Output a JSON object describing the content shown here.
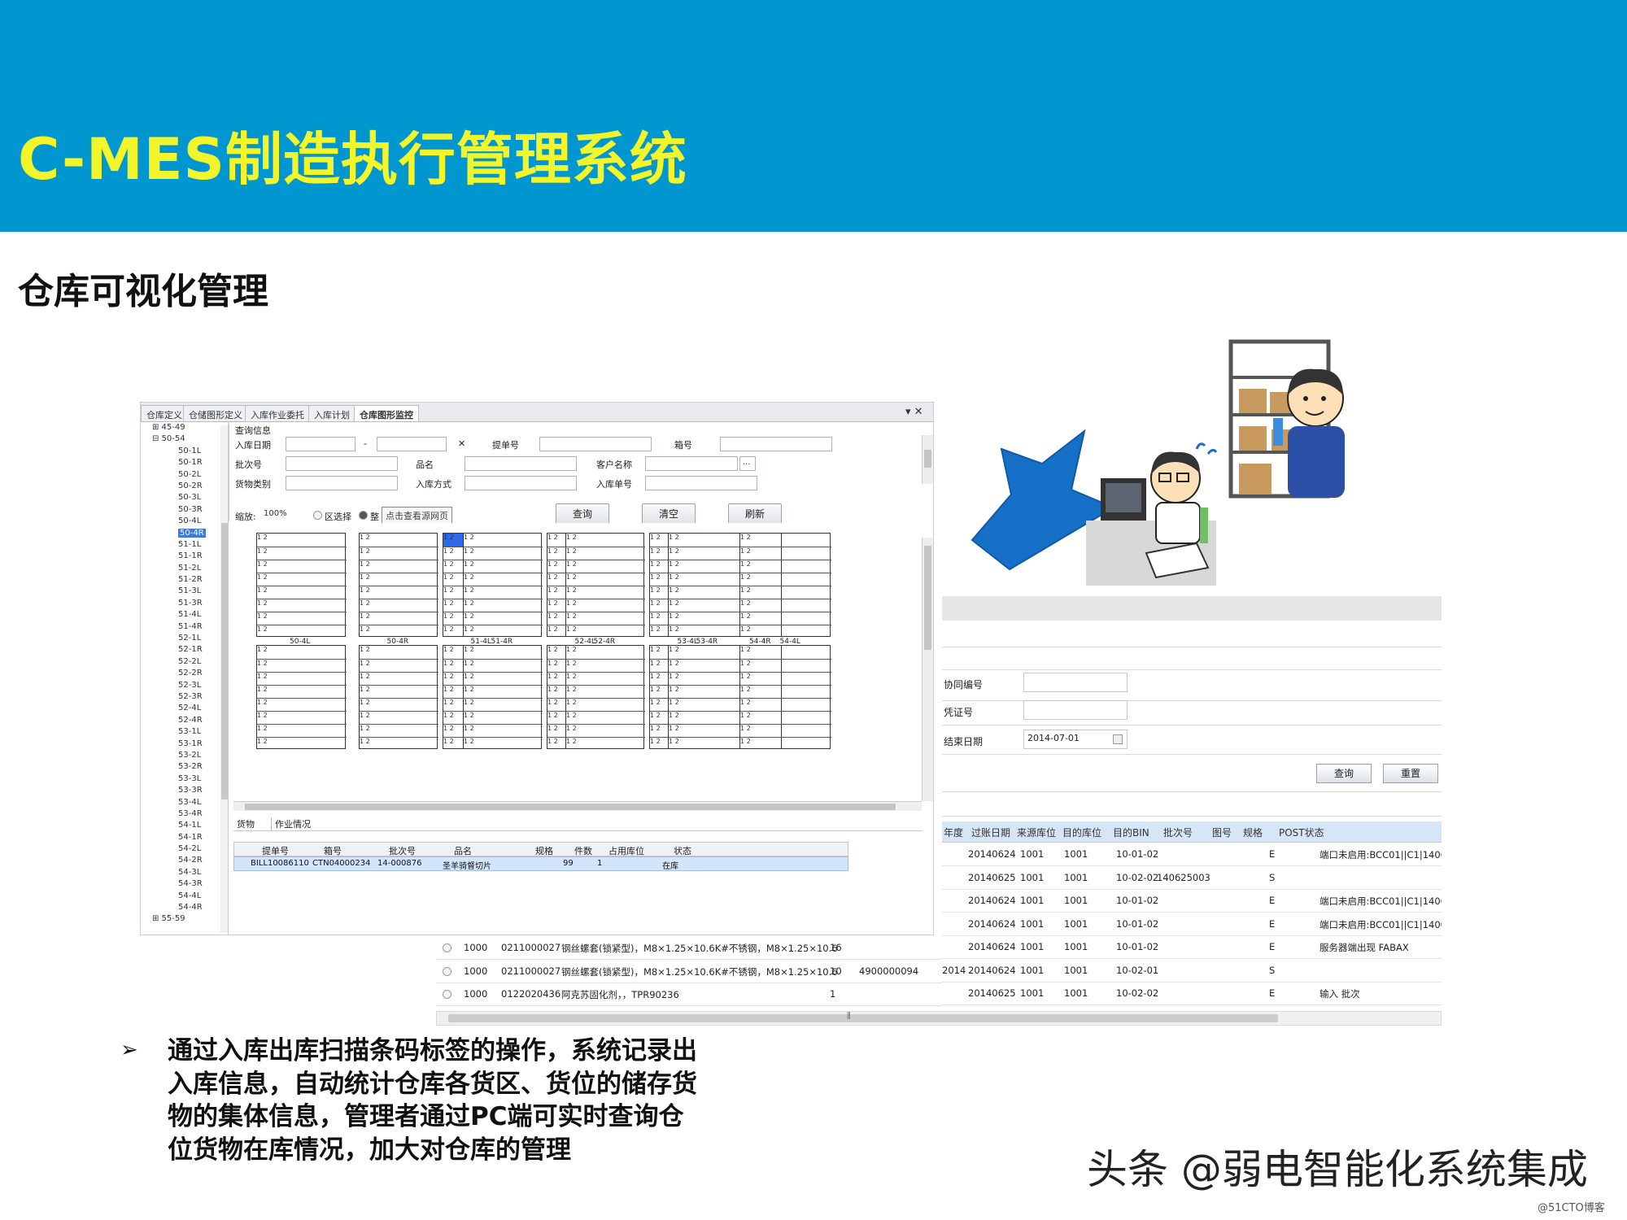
{
  "slide": {
    "title": "C-MES制造执行管理系统",
    "subtitle": "仓库可视化管理",
    "bullet": "➢",
    "body": "通过入库出库扫描条码标签的操作，系统记录出入库信息，自动统计仓库各货区、货位的储存货物的集体信息，管理者通过PC端可实时查询仓位货物在库情况，加大对仓库的管理",
    "watermark": "头条 @弱电智能化系统集成",
    "watermark_small": "@51CTO博客"
  },
  "colors": {
    "banner": "#0096cf",
    "title": "#f2f52a",
    "arrow": "#1670c8",
    "selection": "#2c68e8"
  },
  "left_app": {
    "tabs": [
      "仓库定义",
      "仓储图形定义",
      "入库作业委托",
      "入库计划",
      "仓库图形监控"
    ],
    "tab_controls": "▾ ✕",
    "tree": {
      "groups": [
        "⊞ 45-49",
        "⊟ 50-54",
        "⊞ 55-59"
      ],
      "items": [
        "50-1L",
        "50-1R",
        "50-2L",
        "50-2R",
        "50-3L",
        "50-3R",
        "50-4L",
        "50-4R",
        "51-1L",
        "51-1R",
        "51-2L",
        "51-2R",
        "51-3L",
        "51-3R",
        "51-4L",
        "51-4R",
        "52-1L",
        "52-1R",
        "52-2L",
        "52-2R",
        "52-3L",
        "52-3R",
        "52-4L",
        "52-4R",
        "53-1L",
        "53-1R",
        "53-2L",
        "53-2R",
        "53-3L",
        "53-3R",
        "53-4L",
        "53-4R",
        "54-1L",
        "54-1R",
        "54-2L",
        "54-2R",
        "54-3L",
        "54-3R",
        "54-4L",
        "54-4R"
      ],
      "selected": "50-4R"
    },
    "query": {
      "section": "查询信息",
      "in_date": "入库日期",
      "dash": "-",
      "bill_no": "提单号",
      "box_no": "箱号",
      "batch_no": "批次号",
      "product": "品名",
      "customer": "客户名称",
      "goods_type": "货物类别",
      "in_method": "入库方式",
      "in_no": "入库单号",
      "ellipsis": "...",
      "clear_x": "✕"
    },
    "toolbar": {
      "zoom_label": "缩放:",
      "zoom_value": "100%",
      "radio_area": "区选择",
      "radio_all": "整",
      "tooltip": "点击查看源网页",
      "query": "查询",
      "clear": "清空",
      "refresh": "刷新"
    },
    "rack_labels_top": [
      "50-4L",
      "50-4R",
      "51-4L",
      "51-4R",
      "52-4L",
      "52-4R",
      "53-4L",
      "53-4R",
      "54-4L",
      "54-4R"
    ],
    "rack_cell_text": "1 2",
    "lower_tabs": [
      "货物",
      "作业情况"
    ],
    "grid": {
      "headers": [
        "提单号",
        "箱号",
        "批次号",
        "品名",
        "规格",
        "件数",
        "占用库位",
        "状态"
      ],
      "row": [
        "BILL10086110",
        "CTN04000234",
        "14-000876",
        "圣羊骑督切片",
        "",
        "99",
        "1",
        "在库"
      ]
    }
  },
  "right_app": {
    "labels": [
      "协同编号",
      "凭证号",
      "结束日期"
    ],
    "end_date": "2014-07-01",
    "buttons": [
      "查询",
      "重置"
    ],
    "headers": [
      "年度",
      "过账日期",
      "来源库位",
      "目的库位",
      "目的BIN",
      "批次号",
      "图号",
      "规格",
      "POST状态"
    ],
    "rows": [
      [
        "",
        "20140624",
        "1001",
        "1001",
        "10-01-02",
        "",
        "",
        "",
        "E",
        "端口未启用:BCC01||C1|1406"
      ],
      [
        "",
        "20140625",
        "1001",
        "1001",
        "10-02-02",
        "140625003",
        "",
        "",
        "S",
        ""
      ],
      [
        "",
        "20140624",
        "1001",
        "1001",
        "10-01-02",
        "",
        "",
        "",
        "E",
        "端口未启用:BCC01||C1|1406"
      ],
      [
        "",
        "20140624",
        "1001",
        "1001",
        "10-01-02",
        "",
        "",
        "",
        "E",
        "端口未启用:BCC01||C1|1406"
      ],
      [
        "",
        "20140624",
        "1001",
        "1001",
        "10-01-02",
        "",
        "",
        "",
        "E",
        "服务器端出现 FABAX"
      ],
      [
        "2014",
        "20140624",
        "1001",
        "1001",
        "10-02-01",
        "",
        "",
        "",
        "S",
        ""
      ],
      [
        "",
        "20140625",
        "1001",
        "1001",
        "10-02-02",
        "",
        "",
        "",
        "E",
        "输入 批次"
      ]
    ]
  },
  "bottom_strip": {
    "rows": [
      [
        "1000",
        "0211000027",
        "钢丝螺套(锁紧型)，M8×1.25×10.6K#不锈钢，M8×1.25×10.6",
        "16",
        ""
      ],
      [
        "1000",
        "0211000027",
        "钢丝螺套(锁紧型)，M8×1.25×10.6K#不锈钢，M8×1.25×10.6",
        "10",
        "4900000094"
      ],
      [
        "1000",
        "0122020436",
        "阿克苏固化剂，，TPR90236",
        "1",
        ""
      ]
    ],
    "scroll_mark": "⫼"
  }
}
